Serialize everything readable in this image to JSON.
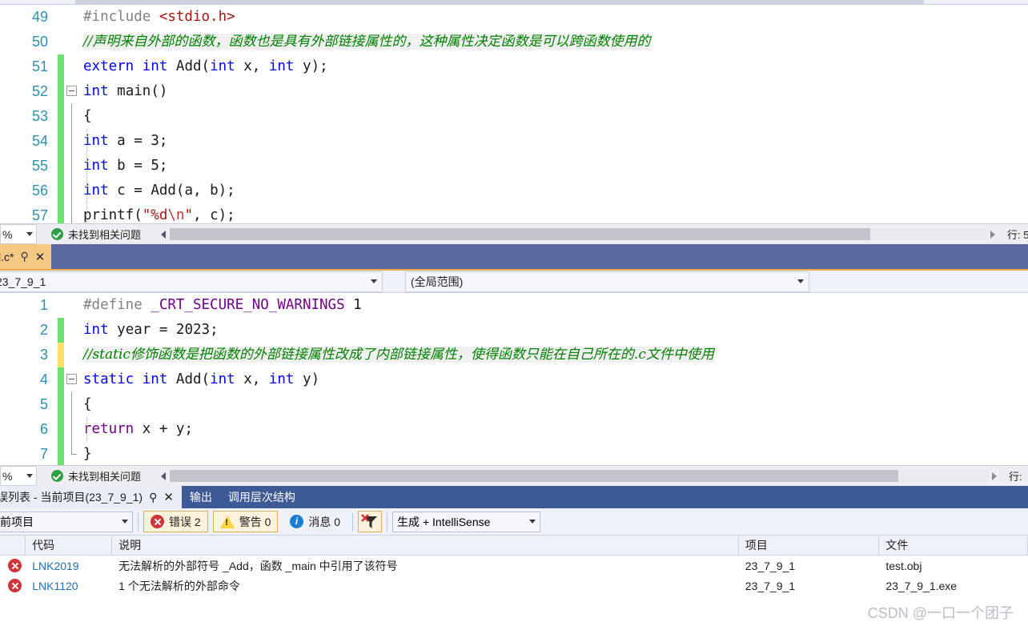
{
  "editor_top": {
    "first_line_number": 49,
    "lines": [
      {
        "num": "49",
        "margin": "none",
        "fold": "none",
        "indent": false,
        "tokens": [
          {
            "t": "#include ",
            "c": "t-pp"
          },
          {
            "t": "<stdio.h>",
            "c": "t-inc"
          }
        ]
      },
      {
        "num": "50",
        "margin": "none",
        "fold": "none",
        "indent": false,
        "comment": "//声明来自外部的函数，函数也是具有外部链接属性的，这种属性决定函数是可以跨函数使用的"
      },
      {
        "num": "51",
        "margin": "saved",
        "fold": "none",
        "indent": false,
        "tokens": [
          {
            "t": "extern ",
            "c": "kw"
          },
          {
            "t": "int ",
            "c": "kw"
          },
          {
            "t": "Add",
            "c": "t-fn"
          },
          {
            "t": "(",
            "c": "t-punct"
          },
          {
            "t": "int ",
            "c": "kw"
          },
          {
            "t": "x",
            "c": "t-id"
          },
          {
            "t": ", ",
            "c": "t-punct"
          },
          {
            "t": "int ",
            "c": "kw"
          },
          {
            "t": "y",
            "c": "t-id"
          },
          {
            "t": ");",
            "c": "t-punct"
          }
        ]
      },
      {
        "num": "52",
        "margin": "saved",
        "fold": "box",
        "indent": false,
        "tokens": [
          {
            "t": "int ",
            "c": "kw"
          },
          {
            "t": "main",
            "c": "t-fn"
          },
          {
            "t": "()",
            "c": "t-punct"
          }
        ]
      },
      {
        "num": "53",
        "margin": "saved",
        "fold": "line",
        "indent": false,
        "tokens": [
          {
            "t": "{",
            "c": "t-punct"
          }
        ]
      },
      {
        "num": "54",
        "margin": "saved",
        "fold": "line",
        "indent": true,
        "tokens": [
          {
            "t": "   int ",
            "c": "kw"
          },
          {
            "t": "a ",
            "c": "t-id"
          },
          {
            "t": "= ",
            "c": "t-punct"
          },
          {
            "t": "3",
            "c": "t-num"
          },
          {
            "t": ";",
            "c": "t-punct"
          }
        ]
      },
      {
        "num": "55",
        "margin": "saved",
        "fold": "line",
        "indent": true,
        "tokens": [
          {
            "t": "   int ",
            "c": "kw"
          },
          {
            "t": "b ",
            "c": "t-id"
          },
          {
            "t": "= ",
            "c": "t-punct"
          },
          {
            "t": "5",
            "c": "t-num"
          },
          {
            "t": ";",
            "c": "t-punct"
          }
        ]
      },
      {
        "num": "56",
        "margin": "saved",
        "fold": "line",
        "indent": true,
        "tokens": [
          {
            "t": "   int ",
            "c": "kw"
          },
          {
            "t": "c ",
            "c": "t-id"
          },
          {
            "t": "= ",
            "c": "t-punct"
          },
          {
            "t": "Add",
            "c": "t-fn"
          },
          {
            "t": "(a, b);",
            "c": "t-punct"
          }
        ]
      },
      {
        "num": "57",
        "margin": "saved",
        "fold": "line",
        "indent": true,
        "tokens": [
          {
            "t": "   printf",
            "c": "t-fn"
          },
          {
            "t": "(",
            "c": "t-punct"
          },
          {
            "t": "\"%d",
            "c": "t-str"
          },
          {
            "t": "\\n",
            "c": "t-esc"
          },
          {
            "t": "\"",
            "c": "t-str"
          },
          {
            "t": ", c);",
            "c": "t-punct"
          }
        ]
      }
    ],
    "status": {
      "zoom": "%",
      "problems": "未找到相关问题",
      "line_indicator": "行: 5"
    }
  },
  "tabstrip": {
    "active_tab": "l.c*",
    "pin_icon": "pin-icon",
    "close_icon": "close-icon"
  },
  "navbar": {
    "project_scope": "23_7_9_1",
    "member_scope": "(全局范围)"
  },
  "editor_bottom": {
    "lines": [
      {
        "num": "1",
        "margin": "none",
        "fold": "none",
        "indent": false,
        "tokens": [
          {
            "t": "#define ",
            "c": "t-pp"
          },
          {
            "t": "_CRT_SECURE_NO_WARNINGS",
            "c": "t-macro"
          },
          {
            "t": " 1",
            "c": "t-num"
          }
        ]
      },
      {
        "num": "2",
        "margin": "saved",
        "fold": "none",
        "indent": false,
        "tokens": [
          {
            "t": "int ",
            "c": "kw"
          },
          {
            "t": "year ",
            "c": "t-id"
          },
          {
            "t": "= ",
            "c": "t-punct"
          },
          {
            "t": "2023",
            "c": "t-num"
          },
          {
            "t": ";",
            "c": "t-punct"
          }
        ]
      },
      {
        "num": "3",
        "margin": "edited",
        "fold": "none",
        "indent": false,
        "comment": "//static修饰函数是把函数的外部链接属性改成了内部链接属性，使得函数只能在自己所在的.c文件中使用"
      },
      {
        "num": "4",
        "margin": "saved",
        "fold": "box",
        "indent": false,
        "tokens": [
          {
            "t": "static ",
            "c": "kw"
          },
          {
            "t": "int ",
            "c": "kw"
          },
          {
            "t": "Add",
            "c": "t-fn"
          },
          {
            "t": "(",
            "c": "t-punct"
          },
          {
            "t": "int ",
            "c": "kw"
          },
          {
            "t": "x",
            "c": "t-id"
          },
          {
            "t": ", ",
            "c": "t-punct"
          },
          {
            "t": "int ",
            "c": "kw"
          },
          {
            "t": "y",
            "c": "t-id"
          },
          {
            "t": ")",
            "c": "t-punct"
          }
        ]
      },
      {
        "num": "5",
        "margin": "saved",
        "fold": "line",
        "indent": false,
        "tokens": [
          {
            "t": "{",
            "c": "t-punct"
          }
        ]
      },
      {
        "num": "6",
        "margin": "saved",
        "fold": "line",
        "indent": true,
        "tokens": [
          {
            "t": "   return ",
            "c": "t-macro"
          },
          {
            "t": "x ",
            "c": "t-id"
          },
          {
            "t": "+ ",
            "c": "t-punct"
          },
          {
            "t": "y;",
            "c": "t-id"
          }
        ]
      },
      {
        "num": "7",
        "margin": "saved",
        "fold": "endline",
        "indent": false,
        "tokens": [
          {
            "t": "}",
            "c": "t-punct"
          }
        ]
      }
    ],
    "status": {
      "zoom": "%",
      "problems": "未找到相关问题",
      "line_indicator": "行:"
    }
  },
  "bottom_panel": {
    "tabs": [
      {
        "label": "误列表 - 当前项目(23_7_9_1)",
        "active": true,
        "name": "tab-error-list"
      },
      {
        "label": "输出",
        "active": false,
        "name": "tab-output"
      },
      {
        "label": "调用层次结构",
        "active": false,
        "name": "tab-call-hierarchy"
      }
    ],
    "toolbar": {
      "scope_filter": "前项目",
      "errors_label": "错误 2",
      "warnings_label": "警告 0",
      "messages_label": "消息 0",
      "clear_filter_icon": "clear-filter-icon",
      "build_filter": "生成 + IntelliSense"
    },
    "grid": {
      "columns": [
        "",
        "代码",
        "说明",
        "项目",
        "文件"
      ],
      "rows": [
        {
          "severity": "error",
          "code": "LNK2019",
          "description": "无法解析的外部符号 _Add，函数 _main 中引用了该符号",
          "project": "23_7_9_1",
          "file": "test.obj"
        },
        {
          "severity": "error",
          "code": "LNK1120",
          "description": "1 个无法解析的外部命令",
          "project": "23_7_9_1",
          "file": "23_7_9_1.exe"
        }
      ]
    }
  },
  "watermark": "CSDN @一口一个团子"
}
